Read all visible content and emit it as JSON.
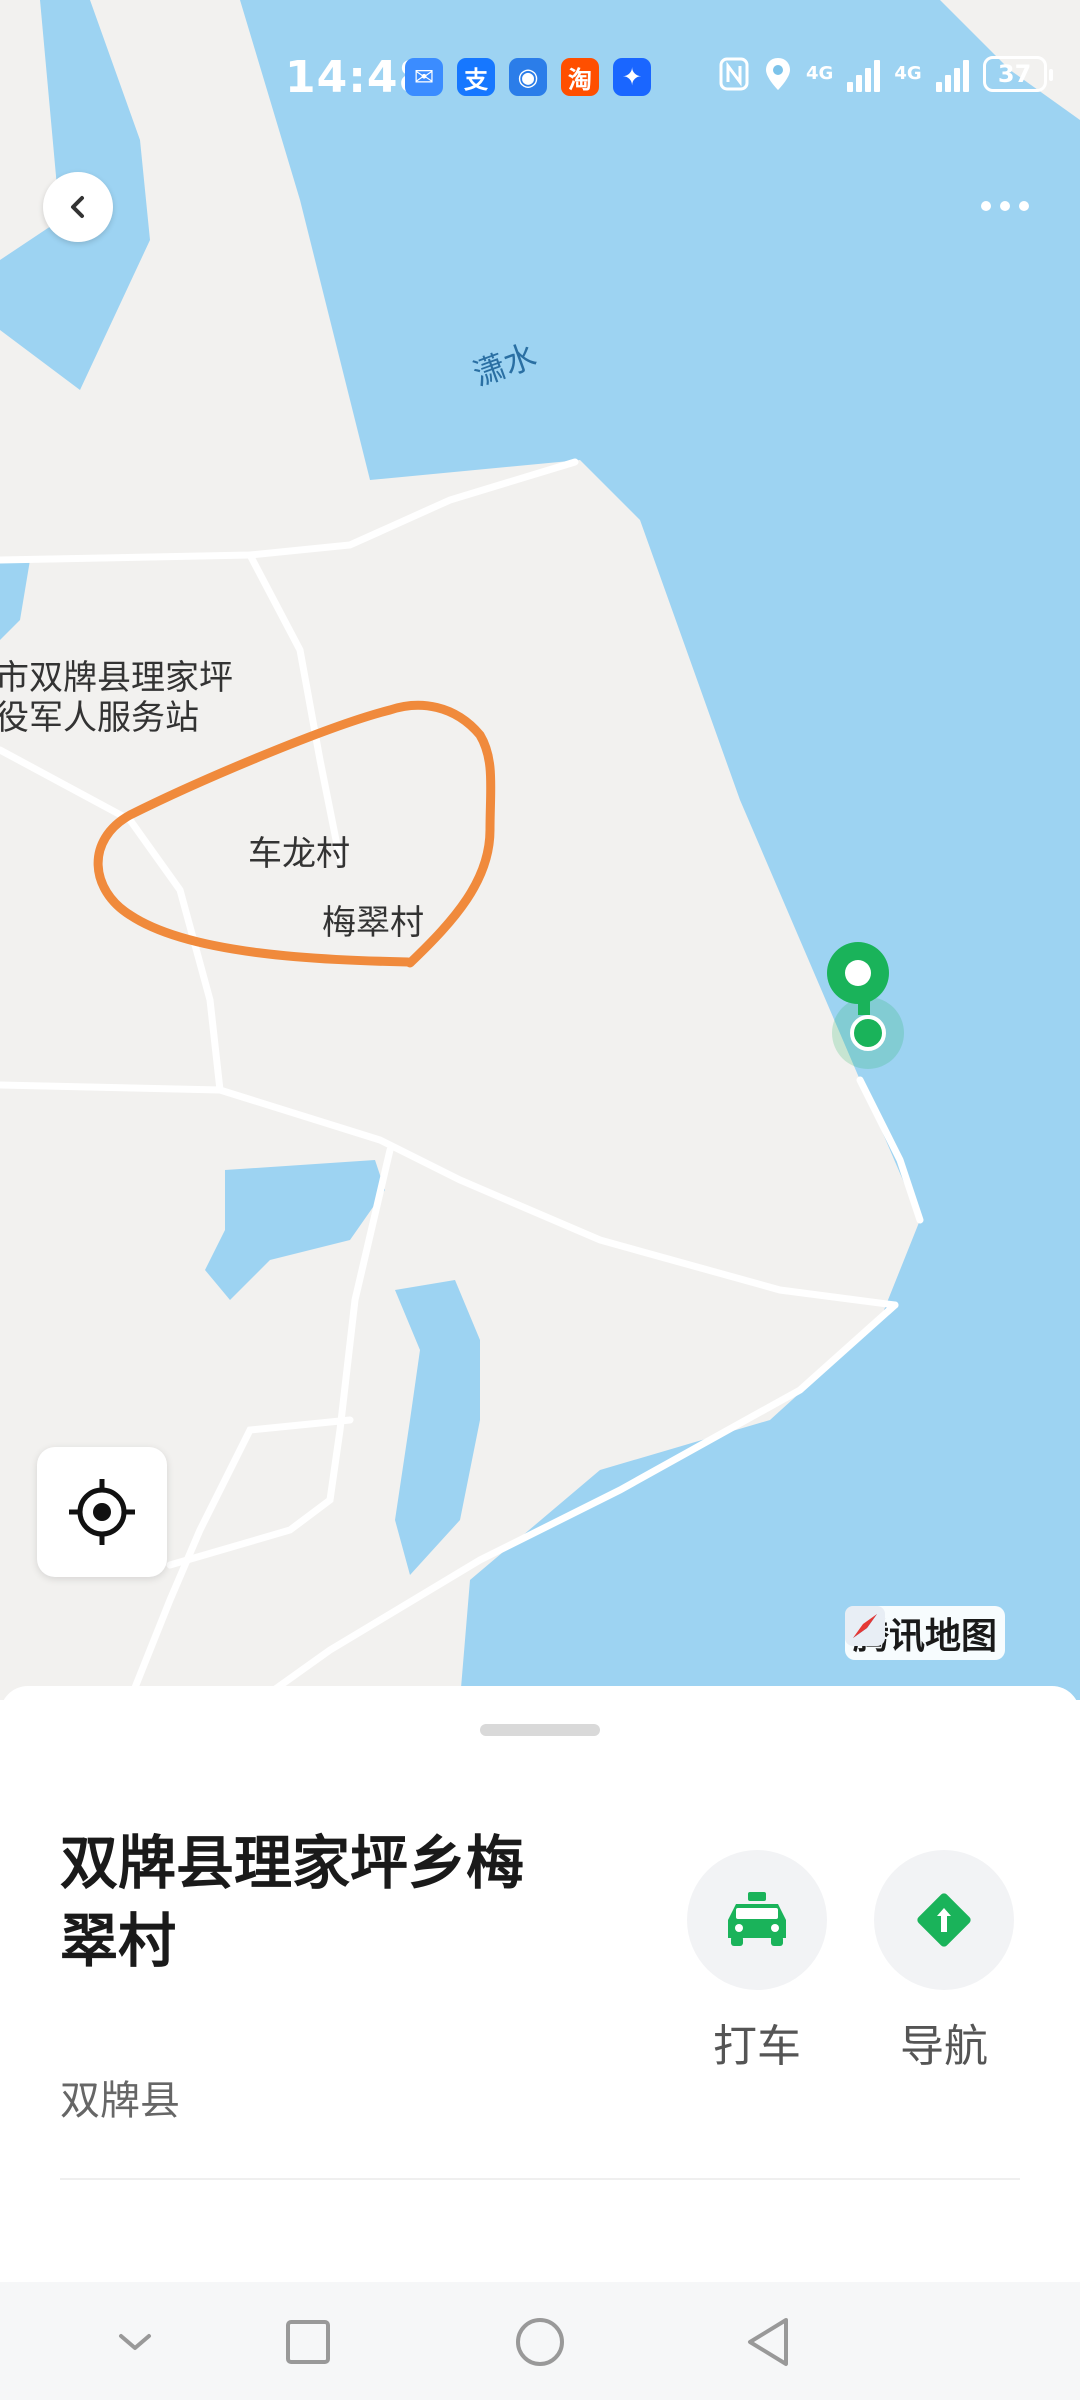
{
  "status_bar": {
    "time": "14:48",
    "app_icons": [
      {
        "name": "mail-icon",
        "glyph": "✉",
        "color": "#3b8cff"
      },
      {
        "name": "alipay-icon",
        "glyph": "支",
        "color": "#1677ff"
      },
      {
        "name": "browser-icon",
        "glyph": "◉",
        "color": "#2b7de9"
      },
      {
        "name": "taobao-icon",
        "glyph": "淘",
        "color": "#ff4f00"
      },
      {
        "name": "bulb-icon",
        "glyph": "✦",
        "color": "#1a66ff"
      }
    ],
    "network_1": "4G",
    "network_2": "4G",
    "battery": "37"
  },
  "map": {
    "water_label": "潇水",
    "labels": {
      "service_station_line1": "市双牌县理家坪",
      "service_station_line2": "役军人服务站",
      "village_1": "车龙村",
      "village_2": "梅翠村"
    },
    "brand": "腾讯地图",
    "colors": {
      "water": "#9dd3f2",
      "land": "#f2f1ef",
      "road": "#ffffff",
      "marker": "#1ab35a",
      "drawn_path": "#f08a3c"
    }
  },
  "place": {
    "title": "双牌县理家坪乡梅翠村",
    "subtitle": "双牌县"
  },
  "actions": {
    "taxi_label": "打车",
    "nav_label": "导航"
  }
}
